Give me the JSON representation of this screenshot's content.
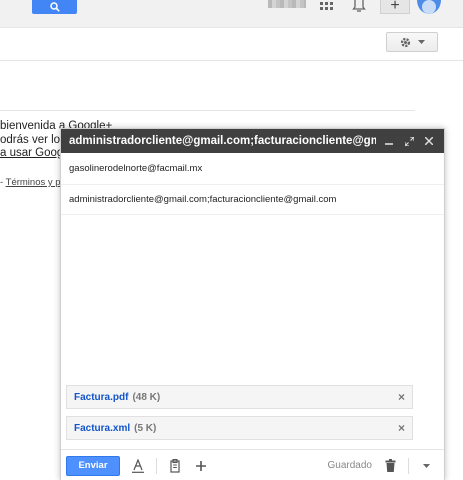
{
  "background": {
    "intro_lines": [
      "bienvenida a Google+",
      "odrás ver los c",
      "a usar Google"
    ],
    "terms_prefix": "- ",
    "terms_link": "Términos y priv"
  },
  "compose": {
    "header_title": "administradorcliente@gmail.com;facturacioncliente@gmail.com",
    "from_value": "gasolinerodelnorte@facmail.mx",
    "to_value": "administradorcliente@gmail.com;facturacioncliente@gmail.com",
    "attachments": [
      {
        "name": "Factura.pdf",
        "size": "(48 K)"
      },
      {
        "name": "Factura.xml",
        "size": "(5 K)"
      }
    ],
    "send_label": "Enviar",
    "status": "Guardado"
  },
  "colors": {
    "accent": "#4285f4",
    "send_button": "#4d90fe",
    "compose_header": "#404040",
    "link": "#1155cc"
  },
  "icons": [
    "search-icon",
    "apps-grid-icon",
    "bell-icon",
    "plus-icon",
    "avatar",
    "gear-icon",
    "minimize-icon",
    "expand-icon",
    "close-icon",
    "text-format-icon",
    "attach-icon",
    "insert-plus-icon",
    "trash-icon",
    "chevron-down-icon"
  ]
}
